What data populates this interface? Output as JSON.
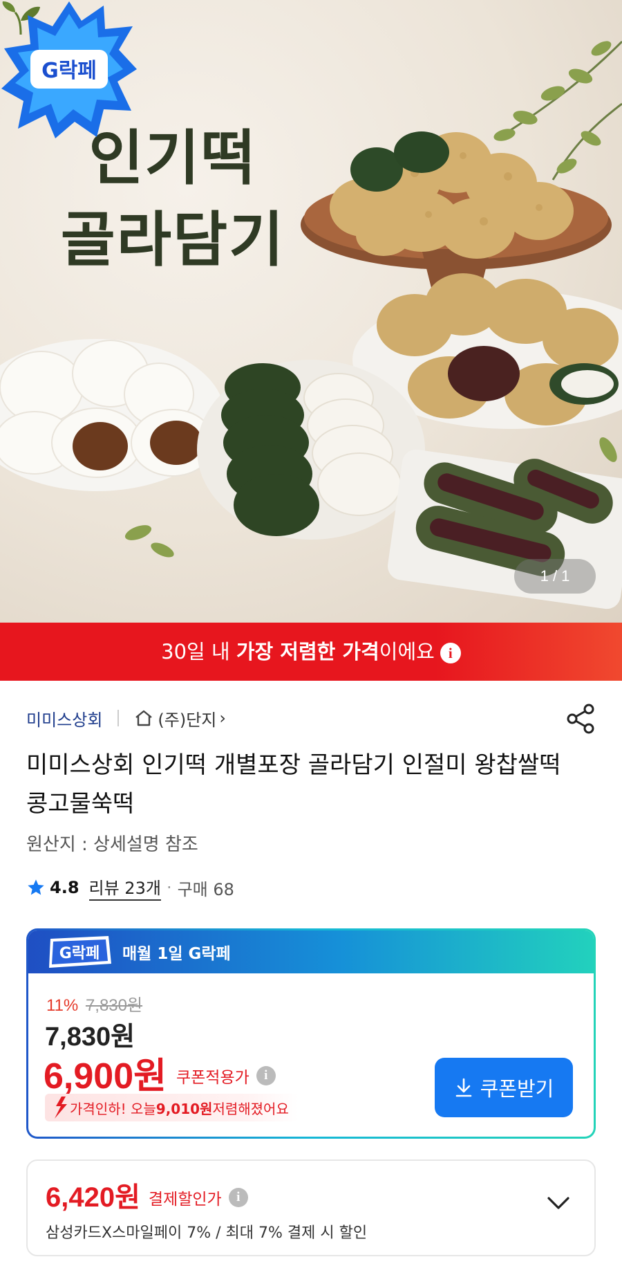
{
  "hero": {
    "title_line1": "인기떡",
    "title_line2": "골라담기",
    "image_counter": "1 / 1",
    "badge_text": "G락페"
  },
  "banner": {
    "prefix": "30일 내 ",
    "emphasis": "가장 저렴한 가격",
    "suffix": "이에요",
    "info_symbol": "i",
    "color": "#e7161e"
  },
  "product": {
    "seller": "미미스상회",
    "store": "(주)단지",
    "store_chevron": "›",
    "title": "미미스상회 인기떡 개별포장 골라담기 인절미 왕찹쌀떡 콩고물쑥떡",
    "origin": "원산지 : 상세설명 참조",
    "rating": "4.8",
    "reviews": "리뷰 23개",
    "purchases": "구매 68"
  },
  "deal_card": {
    "badge_text": "G락페",
    "header_title": "매월 1일 G락페",
    "discount_rate": "11%",
    "original_price": "7,830원",
    "sale_price": "7,830원",
    "coupon_price": "6,900원",
    "coupon_label": "쿠폰적용가",
    "info_symbol": "i",
    "price_cut_prefix": "가격인하! 오늘 ",
    "price_cut_amount": "9,010원",
    "price_cut_suffix": " 저렴해졌어요",
    "coupon_button": "쿠폰받기",
    "accent_color": "#1679f2"
  },
  "payment_card": {
    "price": "6,420원",
    "label": "결제할인가",
    "info_symbol": "i",
    "description": "삼성카드X스마일페이 7% / 최대 7% 결제 시 할인"
  }
}
